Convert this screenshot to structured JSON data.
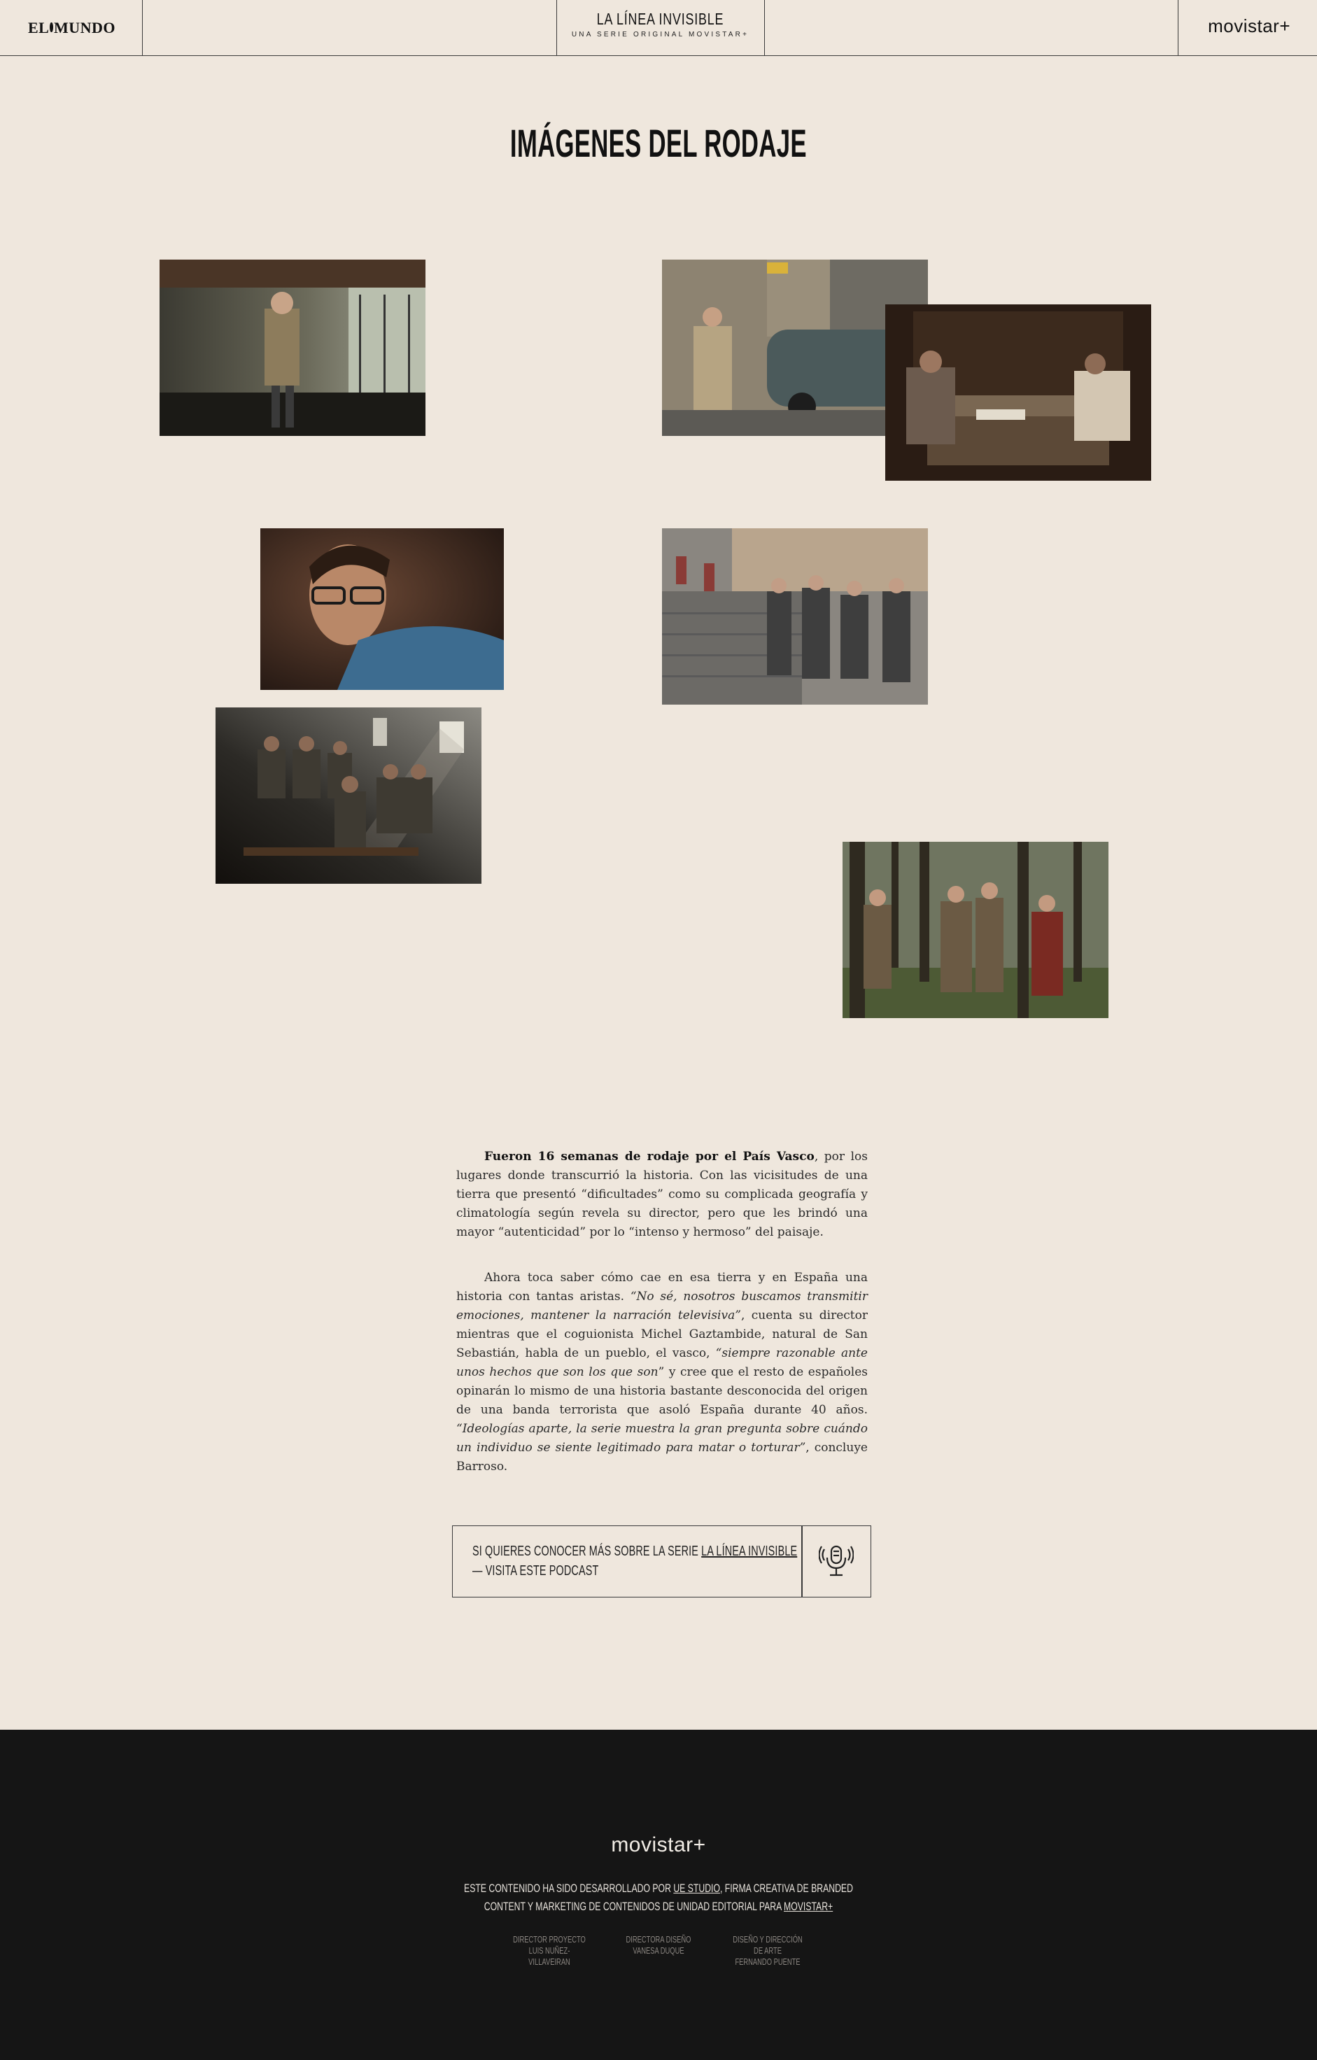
{
  "header": {
    "left_logo": "EL MUNDO",
    "left_logo_a": "EL",
    "left_logo_b": "MUNDO",
    "series_title": "LA LÍNEA INVISIBLE",
    "series_subtitle": "UNA SERIE ORIGINAL MOVISTAR+",
    "right_logo": "movistar+"
  },
  "page_title": "IMÁGENES DEL RODAJE",
  "gallery": {
    "photos": [
      {
        "name": "photo-corridor",
        "icon": "photo-man-in-glass-corridor"
      },
      {
        "name": "photo-man-car",
        "icon": "photo-man-by-car"
      },
      {
        "name": "photo-table-scene",
        "icon": "photo-two-people-at-table"
      },
      {
        "name": "photo-portrait-glasses",
        "icon": "photo-man-with-glasses-portrait"
      },
      {
        "name": "photo-street-crowd",
        "icon": "photo-crowd-on-steps"
      },
      {
        "name": "photo-classroom",
        "icon": "photo-dark-room-seated-men"
      },
      {
        "name": "photo-forest",
        "icon": "photo-group-in-forest"
      }
    ]
  },
  "article": {
    "p1_bold": "Fueron 16 semanas de rodaje por el País Vasco",
    "p1_rest": ", por los lugares donde transcurrió la historia. Con las vicisitudes de una tierra que presentó “dificultades” como su complicada geografía y climatología según revela su director, pero que les brindó una mayor “autenticidad” por lo “intenso y hermoso” del paisaje.",
    "p2_a": "Ahora toca saber cómo cae en esa tierra y en España una historia con tantas aristas. ",
    "p2_b": "“No sé, nosotros buscamos transmitir emociones, mantener la narración televisiva”",
    "p2_c": ", cuenta su director mientras que el coguionista Michel Gaztambide, natural de San Sebastián, habla de un pueblo, el vasco, ",
    "p2_d": "“siempre razonable ante unos hechos que son los que son",
    "p2_e": "” y cree que el resto de españoles opinarán lo mismo de una historia bastante desconocida del origen de una banda terrorista que asoló España durante 40 años. ",
    "p2_f": "“Ideologías aparte, la serie muestra la gran pregunta sobre cuándo un individuo se siente legitimado para matar o torturar”",
    "p2_g": ", concluye Barroso."
  },
  "podcast": {
    "line1_prefix": "SI QUIERES CONOCER MÁS SOBRE LA SERIE ",
    "line1_link": "LA LÍNEA INVISIBLE",
    "line2": "— VISITA ESTE PODCAST",
    "icon": "podcast-microphone-icon"
  },
  "footer": {
    "logo": "movistar+",
    "text_a": "ESTE CONTENIDO HA SIDO DESARROLLADO POR ",
    "link_studio": "UE STUDIO",
    "text_b": ", FIRMA CREATIVA DE BRANDED CONTENT Y MARKETING DE CONTENIDOS DE UNIDAD EDITORIAL PARA ",
    "link_movistar": "MOVISTAR+",
    "credits": [
      {
        "role": "DIRECTOR PROYECTO",
        "person": "LUIS NUÑEZ-VILLAVEIRAN"
      },
      {
        "role": "DIRECTORA DISEÑO",
        "person": "VANESA DUQUE"
      },
      {
        "role": "DISEÑO Y DIRECCIÓN DE ARTE",
        "person": "FERNANDO PUENTE"
      }
    ]
  }
}
